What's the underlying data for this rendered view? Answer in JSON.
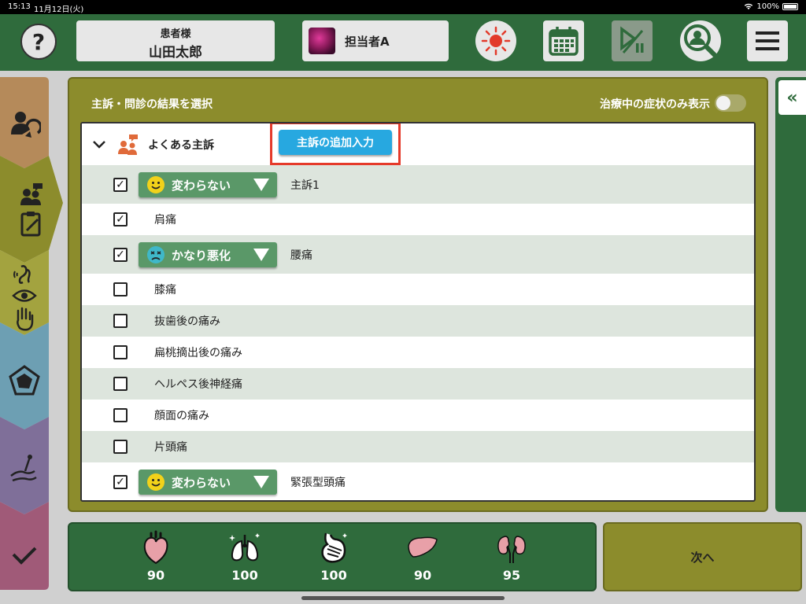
{
  "status_bar": {
    "time": "15:13",
    "date": "11月12日(火)",
    "battery": "100%"
  },
  "header": {
    "patient_label": "患者様",
    "patient_name": "山田太郎",
    "staff_name": "担当者A",
    "icons": [
      "help-icon",
      "sun-icon",
      "calendar-icon",
      "play-pause-icon",
      "user-search-icon",
      "menu-icon"
    ]
  },
  "sidebar": {
    "tabs": [
      {
        "name": "patient-transfer",
        "icon": "user-refresh-icon"
      },
      {
        "name": "interview",
        "icon": "chat-users-icon",
        "active": true
      },
      {
        "name": "senses",
        "icon": "ear-eye-hand-icon"
      },
      {
        "name": "diagnosis",
        "icon": "pentagon-chart-icon"
      },
      {
        "name": "treatment",
        "icon": "acupuncture-icon"
      },
      {
        "name": "confirm",
        "icon": "check-icon"
      }
    ]
  },
  "main": {
    "title": "主訴・問診の結果を選択",
    "toggle_label": "治療中の症状のみ表示",
    "group_title": "よくある主訴",
    "add_button": "主訴の追加入力",
    "rows": [
      {
        "label": "主訴1",
        "checked": true,
        "pill": {
          "text": "変わらない",
          "face": "happy"
        }
      },
      {
        "label": "肩痛",
        "checked": true
      },
      {
        "label": "腰痛",
        "checked": true,
        "pill": {
          "text": "かなり悪化",
          "face": "sad"
        }
      },
      {
        "label": "膝痛",
        "checked": false
      },
      {
        "label": "抜歯後の痛み",
        "checked": false
      },
      {
        "label": "扁桃摘出後の痛み",
        "checked": false
      },
      {
        "label": "ヘルペス後神経痛",
        "checked": false
      },
      {
        "label": "顔面の痛み",
        "checked": false
      },
      {
        "label": "片頭痛",
        "checked": false
      },
      {
        "label": "緊張型頭痛",
        "checked": true,
        "pill": {
          "text": "変わらない",
          "face": "happy"
        }
      }
    ]
  },
  "right_tab": {
    "label": "«"
  },
  "organs": [
    {
      "icon": "heart-icon",
      "value": "90"
    },
    {
      "icon": "lungs-icon",
      "value": "100"
    },
    {
      "icon": "stomach-icon",
      "value": "100"
    },
    {
      "icon": "liver-icon",
      "value": "90"
    },
    {
      "icon": "kidneys-icon",
      "value": "95"
    }
  ],
  "next_button": "次へ",
  "colors": {
    "header_green": "#2f6b3c",
    "panel_olive": "#8c8c2c",
    "add_button_blue": "#27a8e0",
    "highlight_red": "#e53a2a",
    "pill_green": "#5a9868"
  }
}
